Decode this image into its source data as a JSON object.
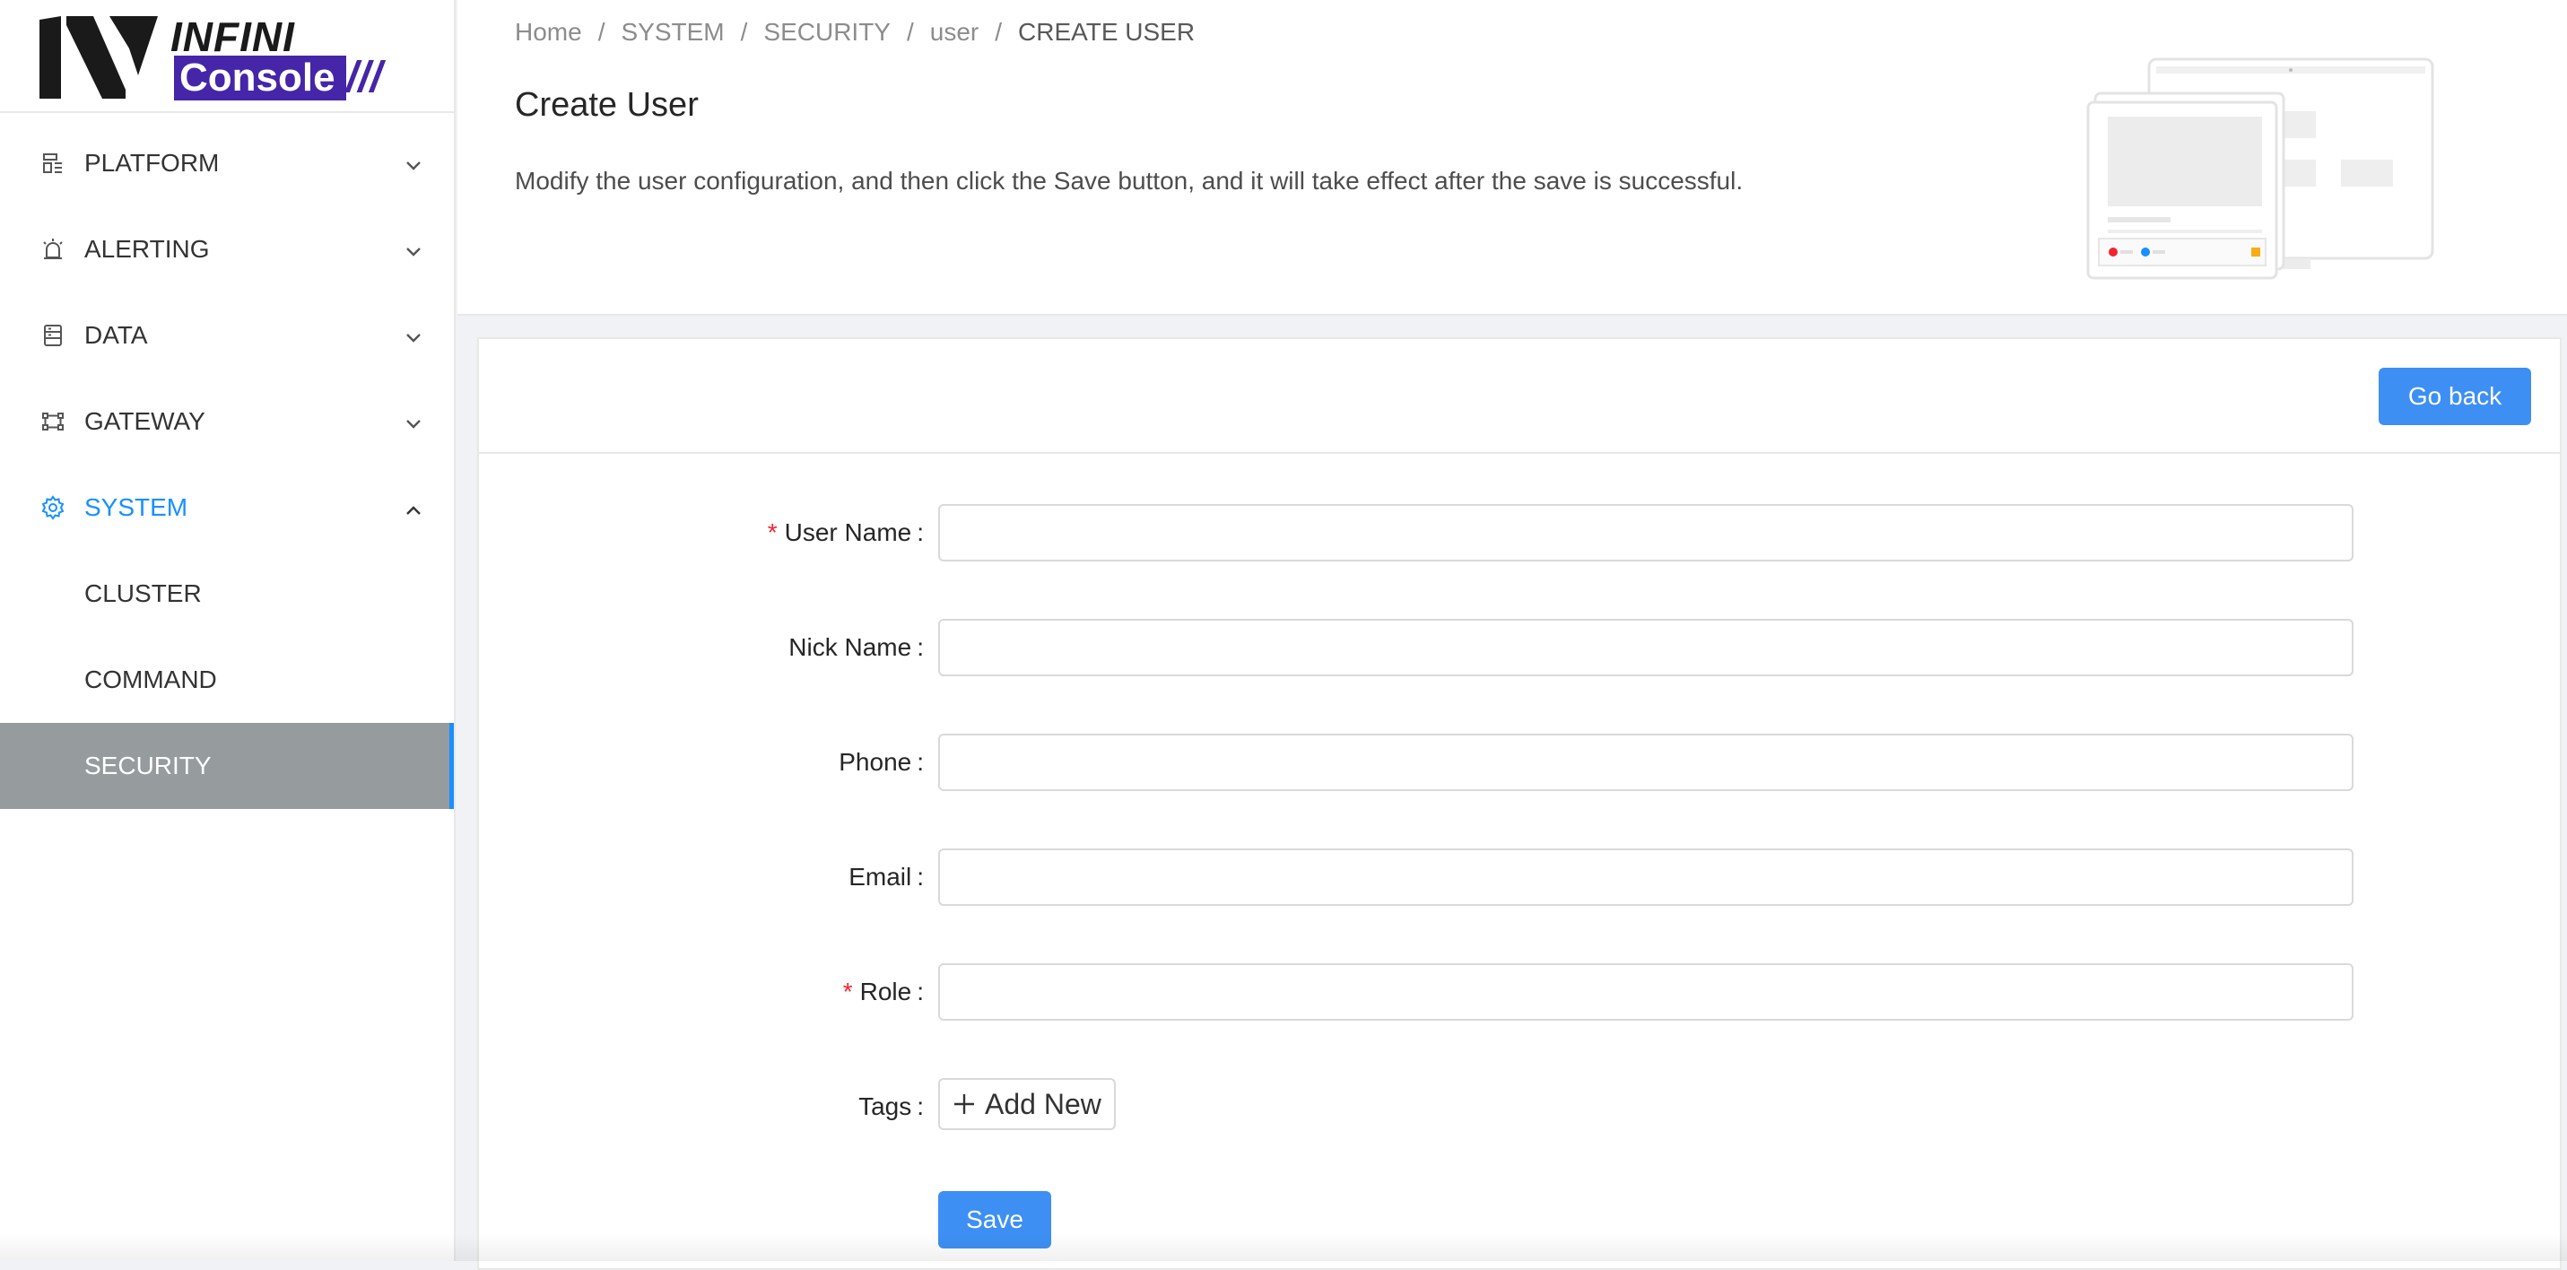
{
  "logo": {
    "line1": "INFINI",
    "line2": "Console",
    "slashes": "///"
  },
  "sidebar": {
    "items": [
      {
        "label": "PLATFORM",
        "icon": "platform-icon"
      },
      {
        "label": "ALERTING",
        "icon": "alarm-icon"
      },
      {
        "label": "DATA",
        "icon": "database-icon"
      },
      {
        "label": "GATEWAY",
        "icon": "gateway-icon"
      },
      {
        "label": "SYSTEM",
        "icon": "gear-icon"
      }
    ],
    "system_children": [
      {
        "label": "CLUSTER"
      },
      {
        "label": "COMMAND"
      },
      {
        "label": "SECURITY"
      }
    ]
  },
  "breadcrumb": {
    "separator": "/",
    "items": [
      "Home",
      "SYSTEM",
      "SECURITY",
      "user",
      "CREATE USER"
    ]
  },
  "header": {
    "title": "Create User",
    "description": "Modify the user configuration, and then click the Save button, and it will take effect after the save is successful."
  },
  "toolbar": {
    "go_back_label": "Go back"
  },
  "form": {
    "required_mark": "*",
    "colon": ":",
    "fields": [
      {
        "label": "User Name",
        "value": "",
        "placeholder": ""
      },
      {
        "label": "Nick Name",
        "value": "",
        "placeholder": ""
      },
      {
        "label": "Phone",
        "value": "",
        "placeholder": ""
      },
      {
        "label": "Email",
        "value": "",
        "placeholder": ""
      },
      {
        "label": "Role",
        "value": "",
        "placeholder": ""
      }
    ],
    "tags_label": "Tags",
    "add_new_label": "Add New",
    "save_label": "Save"
  },
  "colors": {
    "primary": "#3d8ff3",
    "active_menu": "#1890ff",
    "selected_bg": "#969b9e",
    "required": "#f5222d",
    "brand": "#4525a8"
  }
}
